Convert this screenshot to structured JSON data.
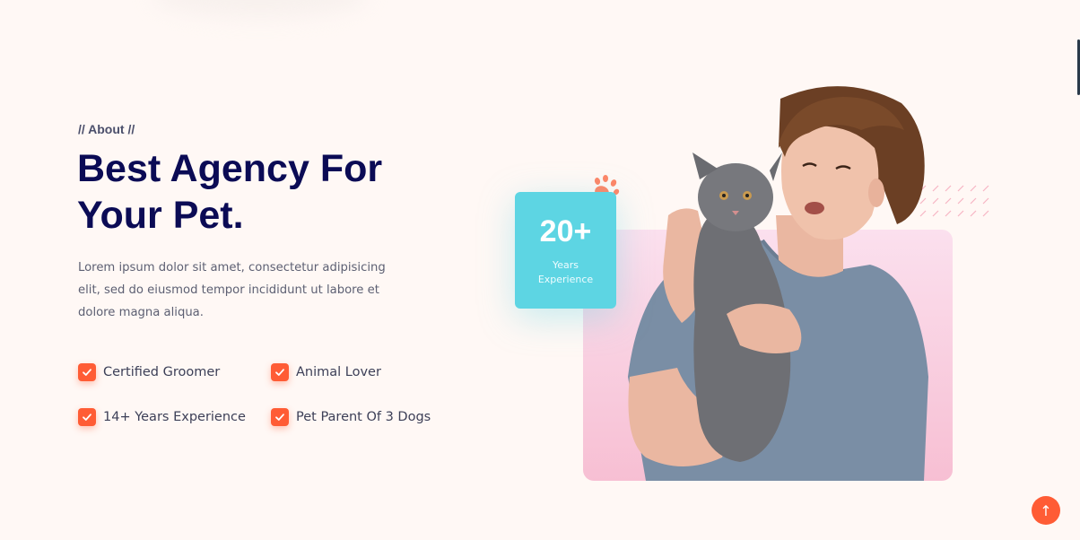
{
  "about": {
    "eyebrow": "// About //",
    "title_line1": "Best Agency For",
    "title_line2": "Your Pet.",
    "description": "Lorem ipsum dolor sit amet, consectetur adipisicing elit, sed do eiusmod tempor incididunt ut labore et dolore magna aliqua."
  },
  "features": [
    "Certified Groomer",
    "Animal Lover",
    "14+ Years Experience",
    "Pet Parent Of 3 Dogs"
  ],
  "stats": {
    "number": "20+",
    "label_line1": "Years",
    "label_line2": "Experience"
  },
  "colors": {
    "accent": "#ff5c35",
    "heading": "#0b0b55",
    "stats_card": "#5dd5e3",
    "pink_card": "#f7bfd3",
    "background": "#fff8f5"
  },
  "icons": {
    "feature": "check-icon",
    "decor": "paw-icon",
    "scroll": "arrow-up-icon"
  }
}
